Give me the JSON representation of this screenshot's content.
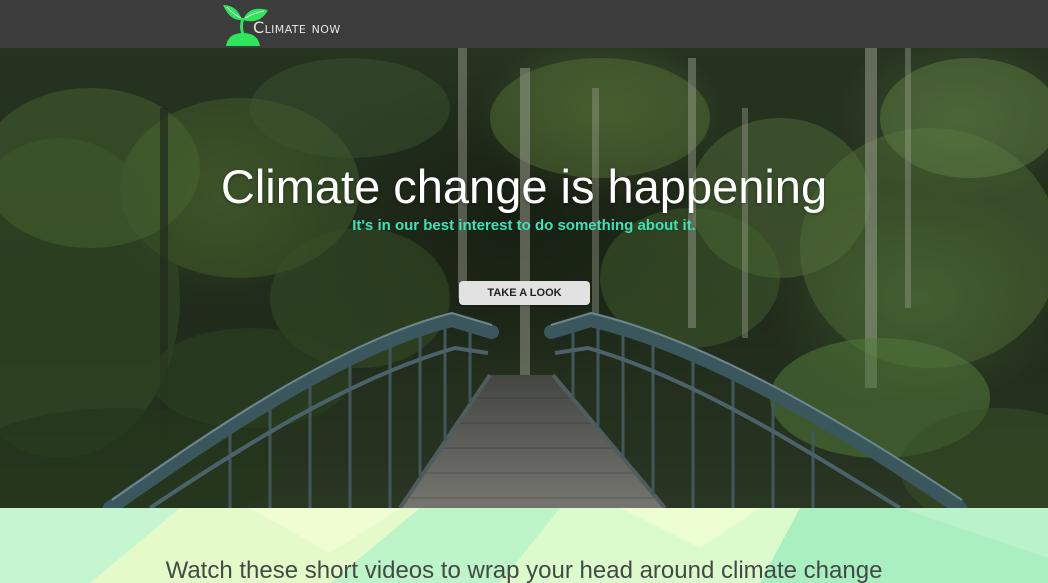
{
  "nav": {
    "brand": "Climate now",
    "logo_icon": "sprout-icon"
  },
  "hero": {
    "title": "Climate change is happening",
    "subtitle": "It's in our best interest to do something about it.",
    "cta_label": "TAKE A LOOK"
  },
  "videos_section": {
    "heading": "Watch these short videos to wrap your head around climate change"
  },
  "colors": {
    "nav_background": "#3c3c3c",
    "logo_green": "#2ee65a",
    "subtitle_accent": "#3fe2b6",
    "button_background": "#e2e2e2",
    "section_background": "#b4f2c6"
  }
}
